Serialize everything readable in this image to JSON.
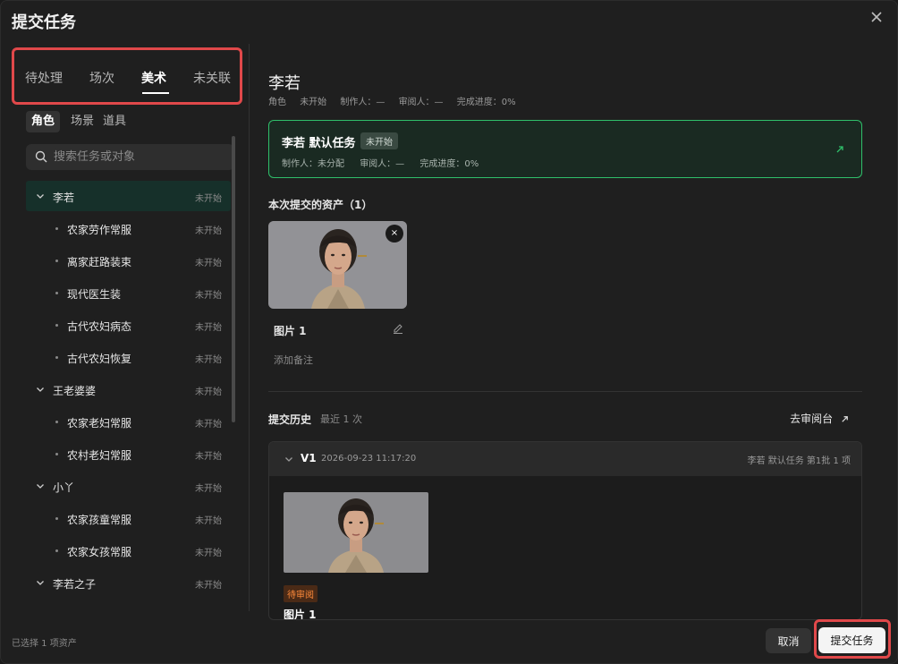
{
  "dialog": {
    "title": "提交任务"
  },
  "left": {
    "tabs": [
      {
        "label": "待处理",
        "active": false
      },
      {
        "label": "场次",
        "active": false
      },
      {
        "label": "美术",
        "active": true
      },
      {
        "label": "未关联",
        "active": false
      }
    ],
    "subtabs": [
      {
        "label": "角色",
        "active": true
      },
      {
        "label": "场景",
        "active": false
      },
      {
        "label": "道具",
        "active": false
      }
    ],
    "search": {
      "placeholder": "搜索任务或对象",
      "value": ""
    },
    "tree": [
      {
        "name": "李若",
        "status": "未开始",
        "type": "parent",
        "selected": true
      },
      {
        "name": "农家劳作常服",
        "status": "未开始",
        "type": "child"
      },
      {
        "name": "离家赶路装束",
        "status": "未开始",
        "type": "child"
      },
      {
        "name": "现代医生装",
        "status": "未开始",
        "type": "child"
      },
      {
        "name": "古代农妇病态",
        "status": "未开始",
        "type": "child"
      },
      {
        "name": "古代农妇恢复",
        "status": "未开始",
        "type": "child"
      },
      {
        "name": "王老婆婆",
        "status": "未开始",
        "type": "parent"
      },
      {
        "name": "农家老妇常服",
        "status": "未开始",
        "type": "child"
      },
      {
        "name": "农村老妇常服",
        "status": "未开始",
        "type": "child"
      },
      {
        "name": "小丫",
        "status": "未开始",
        "type": "parent"
      },
      {
        "name": "农家孩童常服",
        "status": "未开始",
        "type": "child"
      },
      {
        "name": "农家女孩常服",
        "status": "未开始",
        "type": "child"
      },
      {
        "name": "李若之子",
        "status": "未开始",
        "type": "parent"
      }
    ]
  },
  "right": {
    "title": "李若",
    "meta": {
      "role": "角色",
      "status": "未开始",
      "maker": "制作人：—",
      "reviewer": "审阅人：—",
      "progress": "完成进度：0%"
    },
    "task": {
      "name": "李若 默认任务",
      "badge": "未开始",
      "maker": "制作人：未分配",
      "reviewer": "审阅人：—",
      "progress": "完成进度：0%"
    },
    "assets_title": "本次提交的资产（1）",
    "asset": {
      "remove": "×",
      "name": "图片 1",
      "add_note": "添加备注"
    },
    "history": {
      "title": "提交历史",
      "subtitle": "最近 1 次",
      "go_review": "去审阅台",
      "version": {
        "label": "V1",
        "time": "2026-09-23 11:17:20",
        "info": "李若 默认任务 第1批  1 项",
        "status": "待审阅",
        "item_name": "图片 1"
      }
    }
  },
  "footer": {
    "selected": "已选择 1 项资产",
    "cancel": "取消",
    "submit": "提交任务"
  },
  "colors": {
    "accent_green": "#2fbf6a",
    "highlight_red": "#e0484a",
    "pending_orange": "#ff8a3a"
  }
}
